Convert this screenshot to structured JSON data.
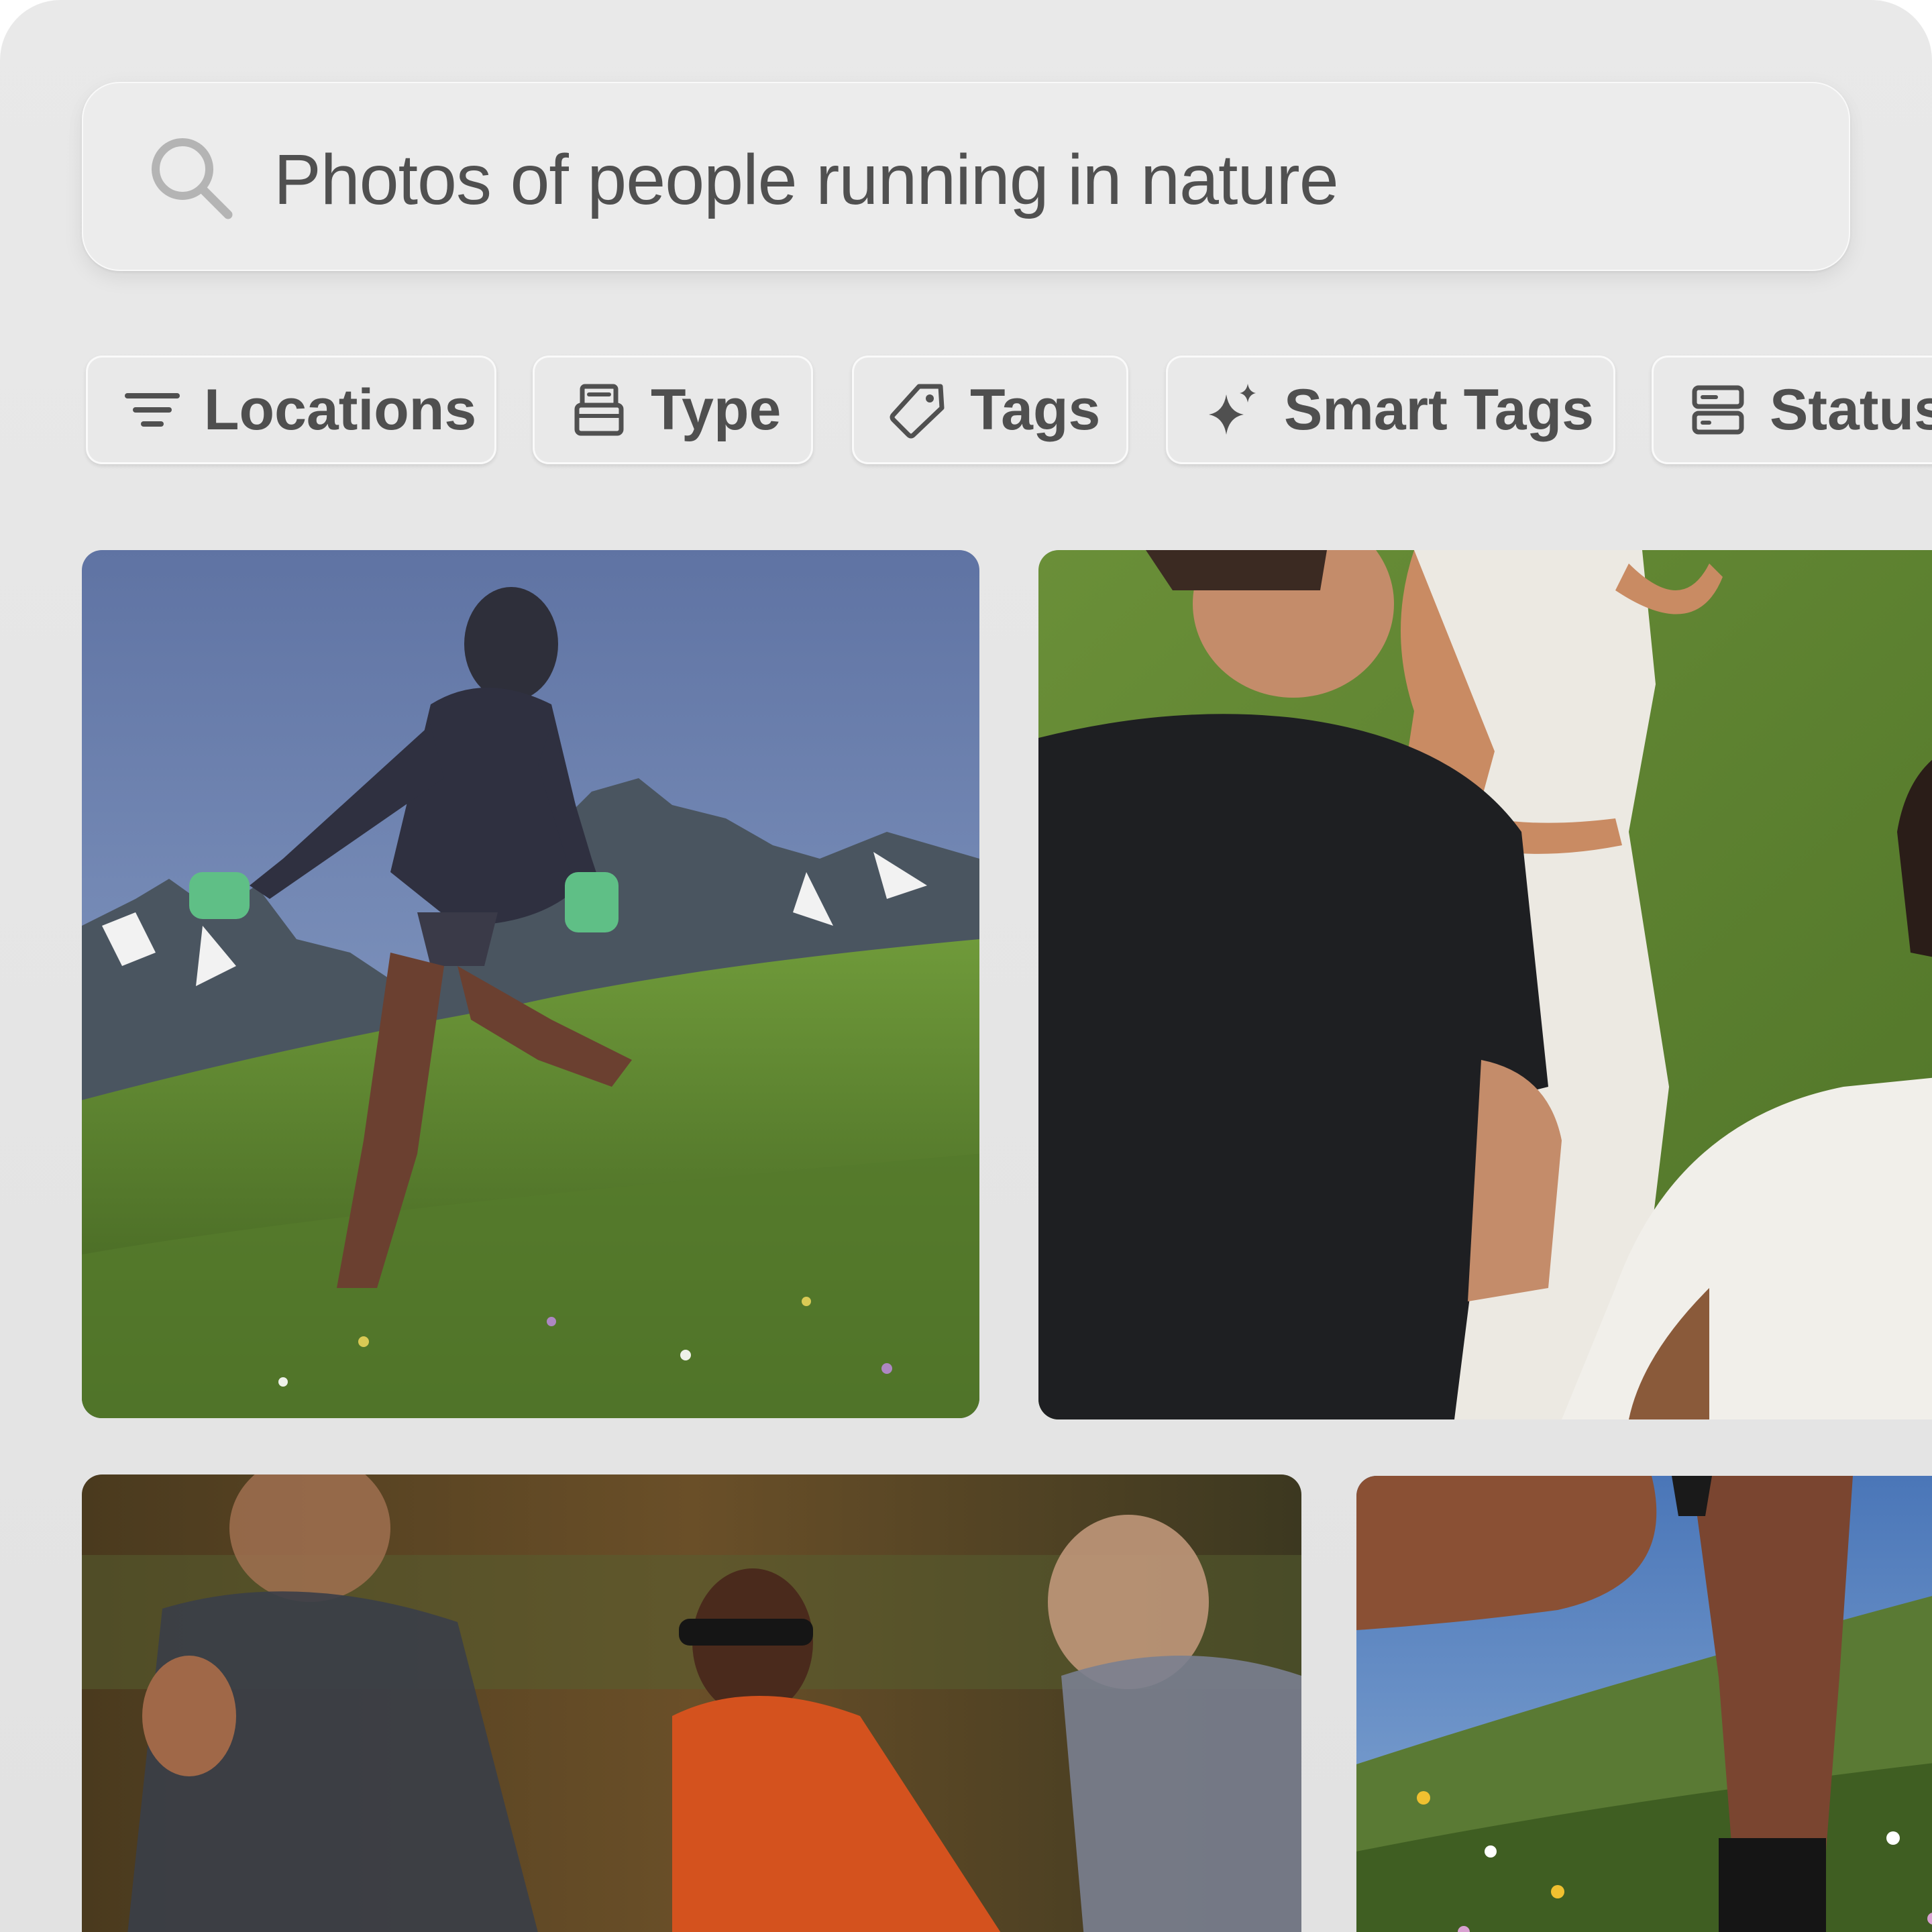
{
  "search": {
    "query": "Photos of people running in nature",
    "icon": "search-icon"
  },
  "filters": [
    {
      "label": "Locations",
      "icon": "filter-lines-icon"
    },
    {
      "label": "Type",
      "icon": "file-type-icon"
    },
    {
      "label": "Tags",
      "icon": "tag-icon"
    },
    {
      "label": "Smart Tags",
      "icon": "sparkle-icon"
    },
    {
      "label": "Status",
      "icon": "status-icon"
    }
  ],
  "results": [
    {
      "subject": "runner in hooded jacket on mountain meadow"
    },
    {
      "subject": "group running on grass"
    },
    {
      "subject": "blurred runners in forest"
    },
    {
      "subject": "runner legs in wildflower field"
    }
  ],
  "colors": {
    "background": "#e6e6e6",
    "search_bg": "#ececec",
    "text": "#505050",
    "chip_text": "#4f4f4f"
  }
}
